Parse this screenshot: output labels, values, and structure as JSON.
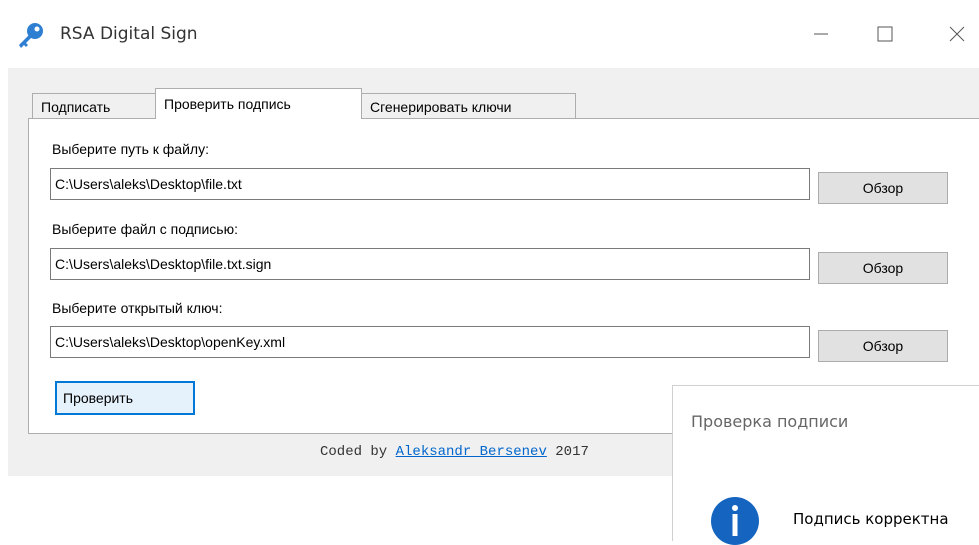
{
  "window": {
    "title": "RSA Digital Sign",
    "icon": "key-icon"
  },
  "tabs": [
    {
      "label": "Подписать",
      "active": false
    },
    {
      "label": "Проверить подпись",
      "active": true
    },
    {
      "label": "Сгенерировать ключи",
      "active": false
    }
  ],
  "form": {
    "file_label": "Выберите путь к файлу:",
    "file_value": "C:\\Users\\aleks\\Desktop\\file.txt",
    "sign_label": "Выберите файл с подписью:",
    "sign_value": "C:\\Users\\aleks\\Desktop\\file.txt.sign",
    "key_label": "Выберите открытый ключ:",
    "key_value": "C:\\Users\\aleks\\Desktop\\openKey.xml",
    "browse_label": "Обзор",
    "verify_label": "Проверить"
  },
  "footer": {
    "prefix": "Coded by ",
    "author": "Aleksandr Bersenev",
    "year": " 2017"
  },
  "message_box": {
    "title": "Проверка подписи",
    "icon": "info-icon",
    "text": "Подпись корректна"
  },
  "colors": {
    "accent": "#0078d7",
    "link": "#0066cc",
    "info_icon": "#1565c0"
  }
}
